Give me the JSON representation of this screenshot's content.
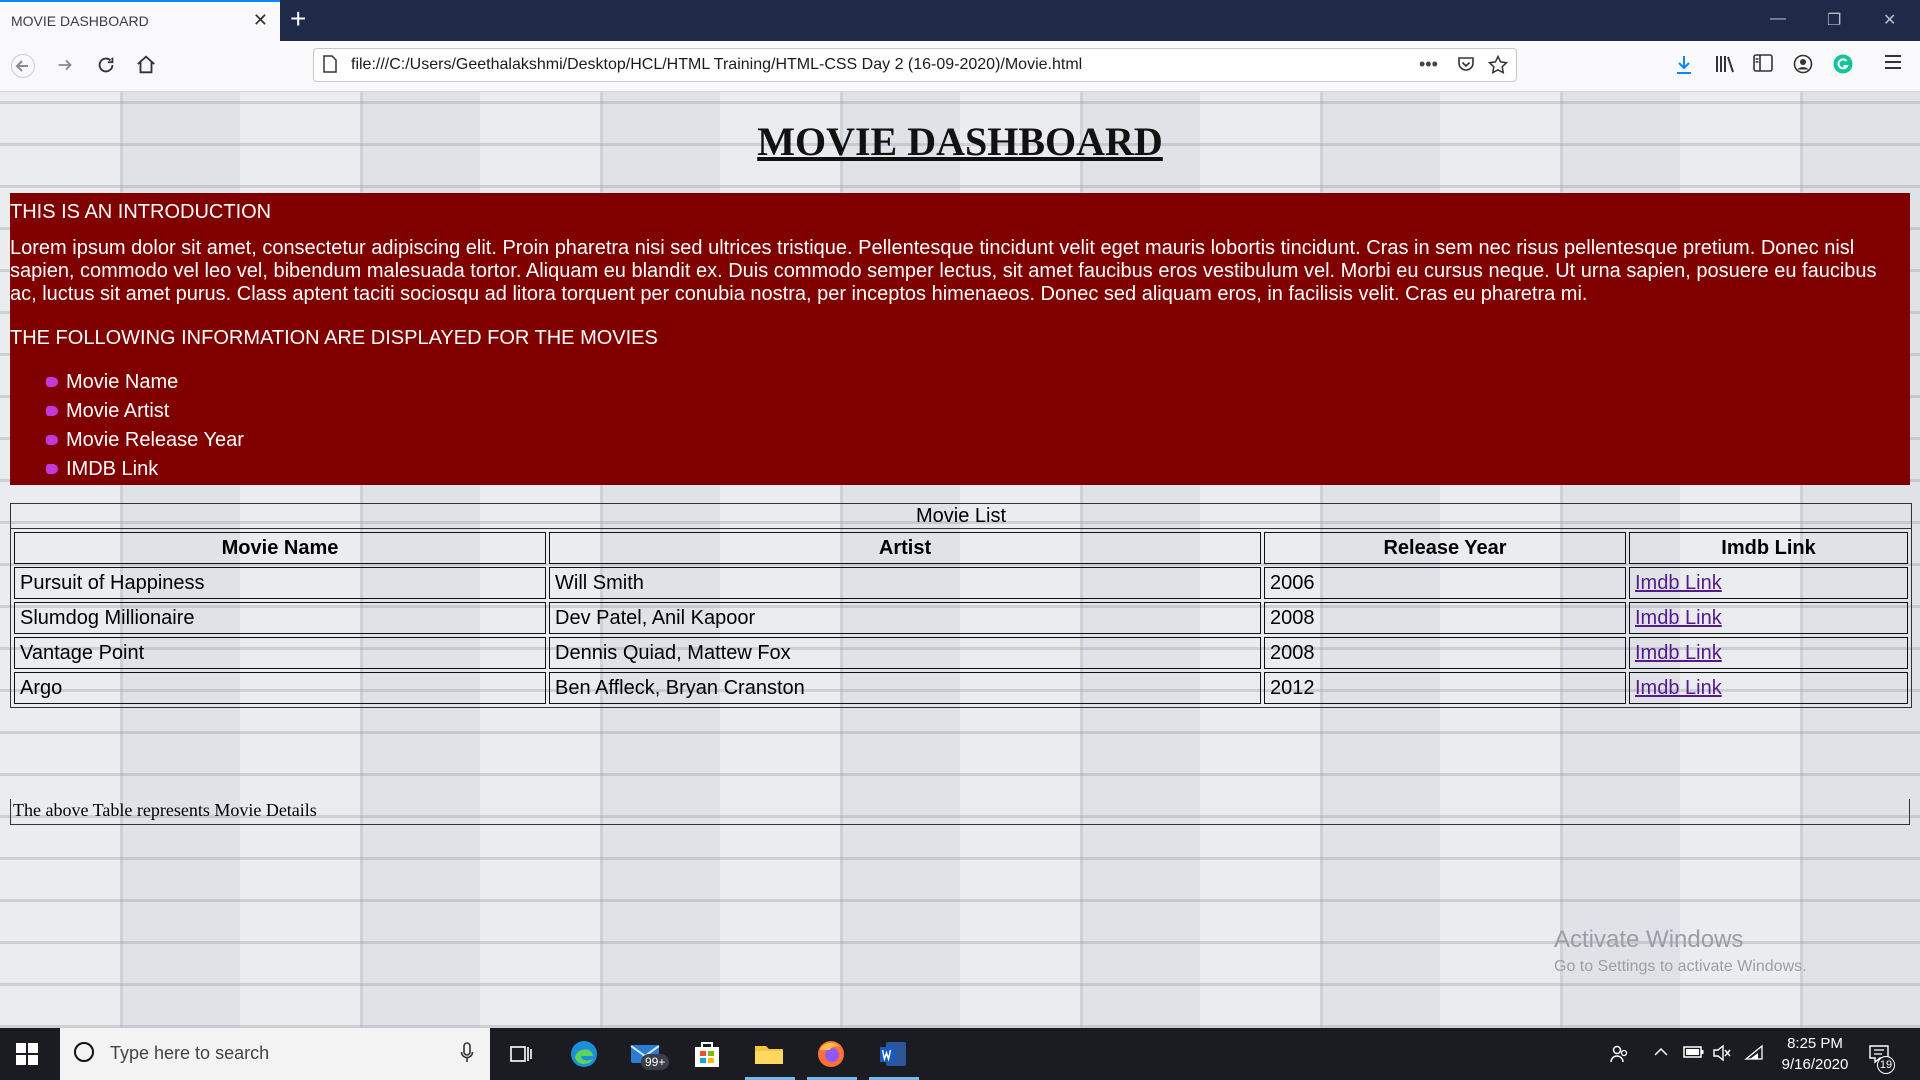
{
  "browser": {
    "tab_title": "MOVIE DASHBOARD",
    "tab_close": "✕",
    "new_tab": "+",
    "window_controls": {
      "minimize": "—",
      "restore": "❐",
      "close": "✕"
    },
    "url": "file:///C:/Users/Geethalakshmi/Desktop/HCL/HTML Training/HTML-CSS Day 2 (16-09-2020)/Movie.html",
    "url_actions": {
      "more": "•••"
    }
  },
  "page": {
    "title": "MOVIE DASHBOARD",
    "intro": {
      "heading": "THIS IS AN INTRODUCTION",
      "paragraph": "Lorem ipsum dolor sit amet, consectetur adipiscing elit. Proin pharetra nisi sed ultrices tristique. Pellentesque tincidunt velit eget mauris lobortis tincidunt. Cras in sem nec risus pellentesque pretium. Donec nisl sapien, commodo vel leo vel, bibendum malesuada tortor. Aliquam eu blandit ex. Duis commodo semper lectus, sit amet faucibus eros vestibulum vel. Morbi eu cursus neque. Ut urna sapien, posuere eu faucibus ac, luctus sit amet purus. Class aptent taciti sociosqu ad litora torquent per conubia nostra, per inceptos himenaeos. Donec sed aliquam eros, in facilisis velit. Cras eu pharetra mi.",
      "info_heading": "THE FOLLOWING INFORMATION ARE DISPLAYED FOR THE MOVIES",
      "info_items": [
        "Movie Name",
        "Movie Artist",
        "Movie Release Year",
        "IMDB Link"
      ],
      "bullet_color": "#c43ad8",
      "background_color": "#800000"
    },
    "table": {
      "caption": "Movie List",
      "headers": [
        "Movie Name",
        "Artist",
        "Release Year",
        "Imdb Link"
      ],
      "rows": [
        [
          "Pursuit of Happiness",
          "Will Smith",
          "2006",
          "Imdb Link"
        ],
        [
          "Slumdog Millionaire",
          "Dev Patel, Anil Kapoor",
          "2008",
          "Imdb Link"
        ],
        [
          "Vantage Point",
          "Dennis Quiad, Mattew Fox",
          "2008",
          "Imdb Link"
        ],
        [
          "Argo",
          "Ben Affleck, Bryan Cranston",
          "2012",
          "Imdb Link"
        ]
      ],
      "footer": "The above Table represents Movie Details"
    },
    "watermark": {
      "line1": "Activate Windows",
      "line2": "Go to Settings to activate Windows."
    }
  },
  "taskbar": {
    "search_placeholder": "Type here to search",
    "mail_badge": "99+",
    "clock_time": "8:25 PM",
    "clock_date": "9/16/2020",
    "notification_count": "19"
  }
}
